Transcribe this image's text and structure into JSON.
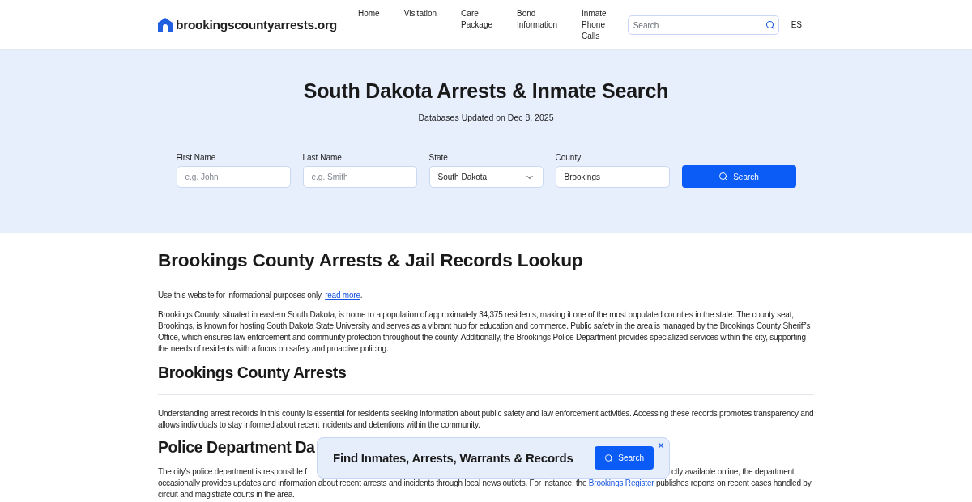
{
  "header": {
    "logo": "brookingscountyarrests.org",
    "nav": [
      "Home",
      "Visitation",
      "Care Package",
      "Bond Information",
      "Inmate Phone Calls"
    ],
    "search": {
      "placeholder": "Search"
    },
    "language": "ES"
  },
  "hero": {
    "title": "South Dakota Arrests & Inmate Search",
    "subtitle": "Databases Updated on Dec 8, 2025",
    "fields": [
      {
        "kind": "text",
        "label": "First Name",
        "placeholder": "e.g. John"
      },
      {
        "kind": "text",
        "label": "Last Name",
        "placeholder": "e.g. Smith"
      },
      {
        "kind": "select",
        "label": "State",
        "value": "South Dakota"
      },
      {
        "kind": "text",
        "label": "County",
        "value": "Brookings"
      }
    ],
    "button": "Search"
  },
  "content": {
    "title": "Brookings County Arrests & Jail Records Lookup",
    "disclaimer": {
      "text": "Use this website for informational purposes only, ",
      "link": "read more",
      "end": "."
    },
    "intro": "Brookings County, situated in eastern South Dakota, is home to a population of approximately 34,375 residents, making it one of the most populated counties in the state. The county seat, Brookings, is known for hosting South Dakota State University and serves as a vibrant hub for education and commerce. Public safety in the area is managed by the Brookings County Sheriff's Office, which ensures law enforcement and community protection throughout the county. Additionally, the Brookings Police Department provides specialized services within the city, supporting the needs of residents with a focus on safety and proactive policing.",
    "arrests": {
      "heading": "Brookings County Arrests",
      "paragraph": "Understanding arrest records in this county is essential for residents seeking information about public safety and law enforcement activities. Accessing these records promotes transparency and allows individuals to stay informed about recent incidents and detentions within the community."
    },
    "police": {
      "heading": "Police Department Da",
      "line_1_left": "The city's police department is responsible f",
      "line_1_right": "ctly available online, the department",
      "rest": {
        "text": "occasionally provides updates and information about recent arrests and incidents through local news outlets. For instance, the ",
        "link": "Brookings Register",
        "end": " publishes reports on recent cases handled by circuit and magistrate courts in the area."
      }
    }
  },
  "banner": {
    "title": "Find Inmates, Arrests, Warrants & Records",
    "button": "Search"
  }
}
